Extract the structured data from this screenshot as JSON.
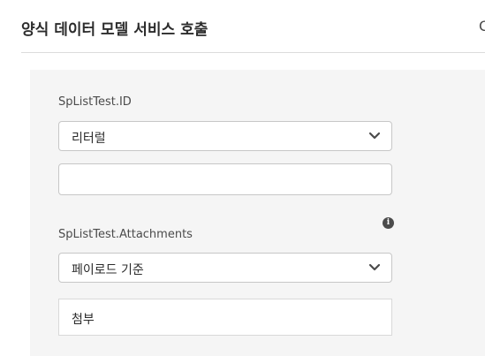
{
  "header": {
    "title": "양식 데이터 모델 서비스 호출",
    "corner_glyph": "C"
  },
  "fields": [
    {
      "label": "SpListTest.ID",
      "select_value": "리터럴",
      "input_value": ""
    },
    {
      "label": "SpListTest.Attachments",
      "select_value": "페이로드 기준",
      "input_value": "첨부"
    }
  ],
  "icons": {
    "info": "info-icon",
    "dropdown": "chevron-down-icon"
  }
}
